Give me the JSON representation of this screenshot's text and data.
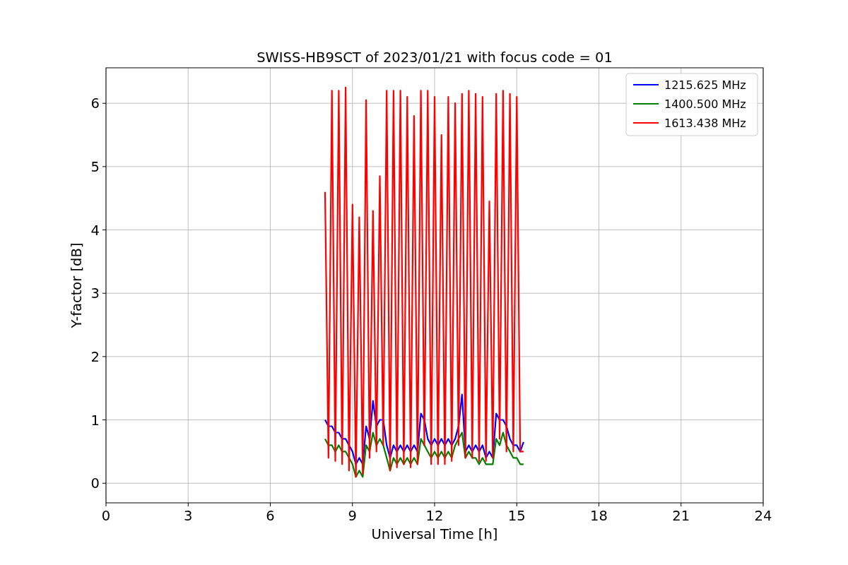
{
  "plot": {
    "chart_data": {
      "type": "line",
      "title": "SWISS-HB9SCT of 2023/01/21 with focus code = 01",
      "xlabel": "Universal Time [h]",
      "ylabel": "Y-factor [dB]",
      "x": [
        8,
        8.125,
        8.25,
        8.375,
        8.5,
        8.625,
        8.75,
        8.875,
        9,
        9.125,
        9.25,
        9.375,
        9.5,
        9.625,
        9.75,
        9.875,
        10,
        10.125,
        10.25,
        10.375,
        10.5,
        10.625,
        10.75,
        10.875,
        11,
        11.125,
        11.25,
        11.375,
        11.5,
        11.625,
        11.75,
        11.875,
        12,
        12.125,
        12.25,
        12.375,
        12.5,
        12.625,
        12.75,
        12.875,
        13,
        13.125,
        13.25,
        13.375,
        13.5,
        13.625,
        13.75,
        13.875,
        14,
        14.125,
        14.25,
        14.375,
        14.5,
        14.625,
        14.75,
        14.875,
        15,
        15.125,
        15.25
      ],
      "series": [
        {
          "name": "1215.625 MHz",
          "color": "#0000ff",
          "values": [
            1.0,
            0.9,
            0.9,
            0.8,
            0.8,
            0.7,
            0.7,
            0.6,
            0.5,
            0.3,
            0.4,
            0.3,
            0.9,
            0.7,
            1.3,
            0.9,
            1.0,
            1.0,
            0.6,
            0.4,
            0.6,
            0.5,
            0.6,
            0.5,
            0.6,
            0.5,
            0.6,
            0.5,
            1.1,
            1.0,
            0.7,
            0.6,
            0.7,
            0.6,
            0.7,
            0.6,
            0.7,
            0.6,
            0.7,
            0.9,
            1.4,
            0.5,
            0.6,
            0.5,
            0.6,
            0.5,
            0.6,
            0.4,
            0.5,
            0.4,
            1.1,
            1.0,
            1.0,
            0.9,
            0.7,
            0.6,
            0.6,
            0.5,
            0.65
          ]
        },
        {
          "name": "1400.500 MHz",
          "color": "#008000",
          "values": [
            0.7,
            0.6,
            0.6,
            0.5,
            0.6,
            0.5,
            0.5,
            0.4,
            0.3,
            0.1,
            0.2,
            0.1,
            0.6,
            0.5,
            0.8,
            0.6,
            0.7,
            0.6,
            0.4,
            0.2,
            0.4,
            0.3,
            0.4,
            0.3,
            0.4,
            0.3,
            0.4,
            0.3,
            0.7,
            0.6,
            0.5,
            0.4,
            0.5,
            0.4,
            0.5,
            0.4,
            0.5,
            0.4,
            0.6,
            0.7,
            0.8,
            0.4,
            0.5,
            0.4,
            0.4,
            0.3,
            0.4,
            0.3,
            0.3,
            0.3,
            0.7,
            0.6,
            0.8,
            0.6,
            0.5,
            0.4,
            0.4,
            0.3,
            0.3
          ]
        },
        {
          "name": "1613.438 MHz",
          "color": "#ff0000",
          "values": [
            4.6,
            0.4,
            6.2,
            0.35,
            6.2,
            0.3,
            6.25,
            0.2,
            4.4,
            0.1,
            4.2,
            0.15,
            6.05,
            0.4,
            4.3,
            0.5,
            4.85,
            0.6,
            6.2,
            0.2,
            6.2,
            0.25,
            6.2,
            0.3,
            6.1,
            0.25,
            5.8,
            0.3,
            6.2,
            0.6,
            6.2,
            0.3,
            6.1,
            0.3,
            5.5,
            0.3,
            6.1,
            0.35,
            6.0,
            0.6,
            6.15,
            0.4,
            6.2,
            0.4,
            6.15,
            0.35,
            6.1,
            0.35,
            4.45,
            0.4,
            6.15,
            0.7,
            6.2,
            0.5,
            6.15,
            0.5,
            6.1,
            0.5,
            0.5
          ]
        }
      ],
      "xlim": [
        0,
        24
      ],
      "ylim": [
        -0.31,
        6.56
      ],
      "xticks": [
        0,
        3,
        6,
        9,
        12,
        15,
        18,
        21,
        24
      ],
      "yticks": [
        0,
        1,
        2,
        3,
        4,
        5,
        6
      ],
      "grid": true,
      "legend": "upper right"
    }
  }
}
